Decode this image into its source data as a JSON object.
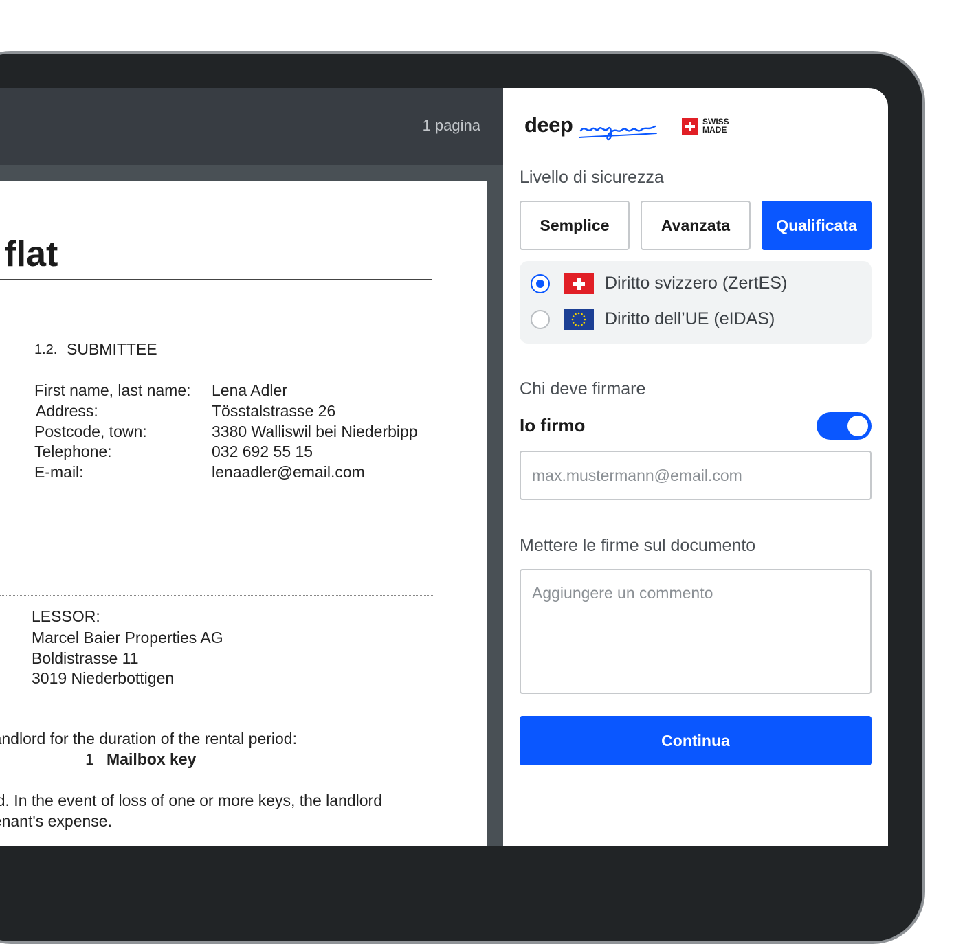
{
  "viewer": {
    "page_count": "1 pagina"
  },
  "document": {
    "title": "Application for flat",
    "submittee_number": "1.2.",
    "submittee_heading": "SUBMITTEE",
    "fields": [
      {
        "label": "First name, last name:",
        "value": "Lena Adler"
      },
      {
        "label": "Address:",
        "value": "Tösstalstrasse 26"
      },
      {
        "label": "Postcode, town:",
        "value": "3380 Walliswil bei Niederbipp"
      },
      {
        "label": "Telephone:",
        "value": "032 692 55 15"
      },
      {
        "label": "E-mail:",
        "value": "lenaadler@email.com"
      }
    ],
    "lessor": {
      "heading": "LESSOR:",
      "lines": [
        "Marcel Baier Properties AG",
        "Boldistrasse 11",
        "3019 Niederbottigen"
      ]
    },
    "keys_sentence": "The tenant receives from the landlord for the duration of the rental period:",
    "keys_qty": "1",
    "keys_item": "Mailbox key",
    "loss_line1": "All keys must be returned. In the event of loss of one or more keys, the landlord",
    "loss_line2": "may replace the locks at the tenant's expense."
  },
  "panel": {
    "logo_text": "deep",
    "logo_script": "sign",
    "swiss_line1": "SWISS",
    "swiss_line2": "MADE",
    "security_label": "Livello di sicurezza",
    "levels": [
      "Semplice",
      "Avanzata",
      "Qualificata"
    ],
    "selected_level": "Qualificata",
    "laws": [
      {
        "label": "Diritto svizzero (ZertES)",
        "selected": true,
        "flag": "swiss-flag-icon"
      },
      {
        "label": "Diritto dell’UE (eIDAS)",
        "selected": false,
        "flag": "eu-flag-icon"
      }
    ],
    "who_label": "Chi deve firmare",
    "self_sign_label": "Io firmo",
    "self_sign_on": true,
    "email_placeholder": "max.mustermann@email.com",
    "place_label": "Mettere le firme sul documento",
    "comment_placeholder": "Aggiungere un commento",
    "continue_label": "Continua",
    "colors": {
      "accent": "#0a57ff",
      "swiss_red": "#e11f26",
      "eu_blue": "#1c3f94"
    }
  }
}
